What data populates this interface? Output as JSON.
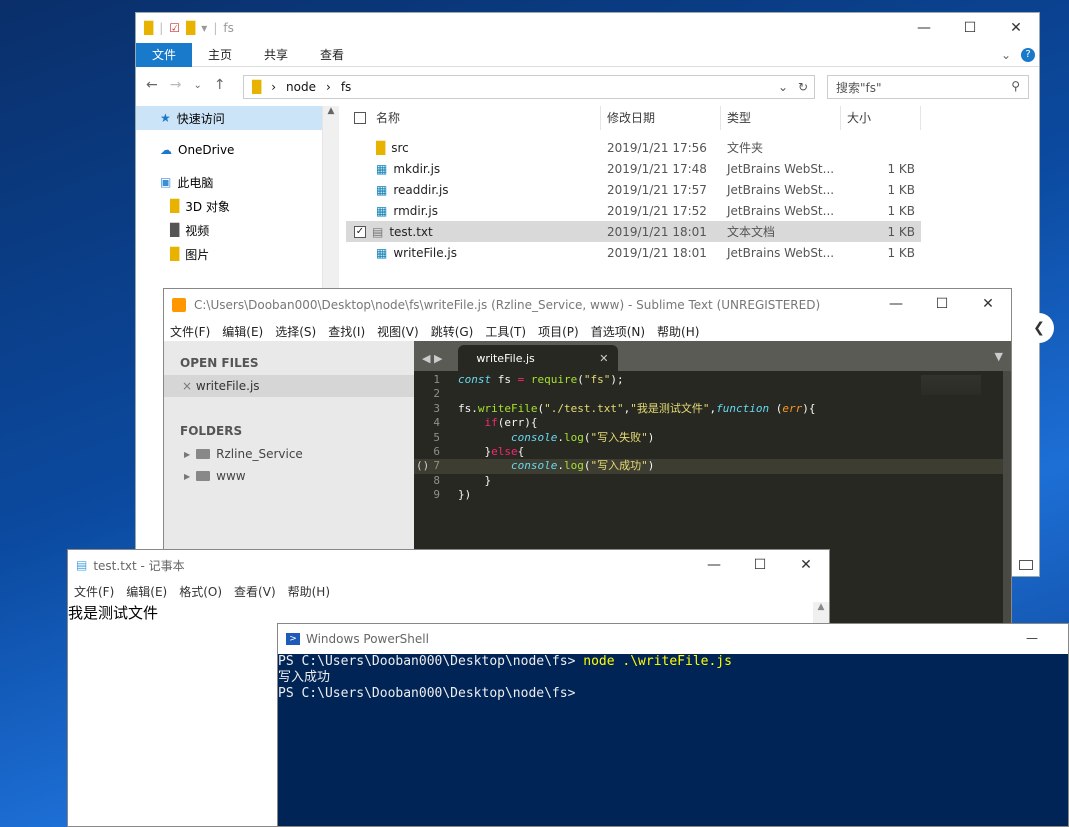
{
  "explorer": {
    "title": "fs",
    "ribbon_tabs": [
      "文件",
      "主页",
      "共享",
      "查看"
    ],
    "address": [
      "node",
      "fs"
    ],
    "search_placeholder": "搜索\"fs\"",
    "nav": [
      {
        "label": "快速访问",
        "icon": "star-icon"
      },
      {
        "label": "OneDrive",
        "icon": "cloud-icon"
      },
      {
        "label": "此电脑",
        "icon": "pc-icon"
      },
      {
        "label": "3D 对象",
        "icon": "folder-icon"
      },
      {
        "label": "视频",
        "icon": "folder-icon"
      },
      {
        "label": "图片",
        "icon": "folder-icon"
      }
    ],
    "columns": [
      "名称",
      "修改日期",
      "类型",
      "大小"
    ],
    "files": [
      {
        "name": "src",
        "date": "2019/1/21 17:56",
        "type": "文件夹",
        "size": ""
      },
      {
        "name": "mkdir.js",
        "date": "2019/1/21 17:48",
        "type": "JetBrains WebSt...",
        "size": "1 KB"
      },
      {
        "name": "readdir.js",
        "date": "2019/1/21 17:57",
        "type": "JetBrains WebSt...",
        "size": "1 KB"
      },
      {
        "name": "rmdir.js",
        "date": "2019/1/21 17:52",
        "type": "JetBrains WebSt...",
        "size": "1 KB"
      },
      {
        "name": "test.txt",
        "date": "2019/1/21 18:01",
        "type": "文本文档",
        "size": "1 KB"
      },
      {
        "name": "writeFile.js",
        "date": "2019/1/21 18:01",
        "type": "JetBrains WebSt...",
        "size": "1 KB"
      }
    ]
  },
  "sublime": {
    "title": "C:\\Users\\Dooban000\\Desktop\\node\\fs\\writeFile.js (Rzline_Service, www) - Sublime Text (UNREGISTERED)",
    "menu": [
      "文件(F)",
      "编辑(E)",
      "选择(S)",
      "查找(I)",
      "视图(V)",
      "跳转(G)",
      "工具(T)",
      "项目(P)",
      "首选项(N)",
      "帮助(H)"
    ],
    "open_files_label": "OPEN FILES",
    "open_file": "writeFile.js",
    "folders_label": "FOLDERS",
    "folders": [
      "Rzline_Service",
      "www"
    ],
    "tab": "writeFile.js",
    "line_numbers": [
      "1",
      "2",
      "3",
      "4",
      "5",
      "6",
      "7",
      "8",
      "9"
    ],
    "fold_marker": "()"
  },
  "notepad": {
    "title": "test.txt - 记事本",
    "menu": [
      "文件(F)",
      "编辑(E)",
      "格式(O)",
      "查看(V)",
      "帮助(H)"
    ],
    "content": "我是测试文件"
  },
  "powershell": {
    "title": "Windows PowerShell",
    "prompt1": "PS C:\\Users\\Dooban000\\Desktop\\node\\fs>",
    "command": "node .\\writeFile.js",
    "output": "写入成功",
    "prompt2": "PS C:\\Users\\Dooban000\\Desktop\\node\\fs>"
  }
}
